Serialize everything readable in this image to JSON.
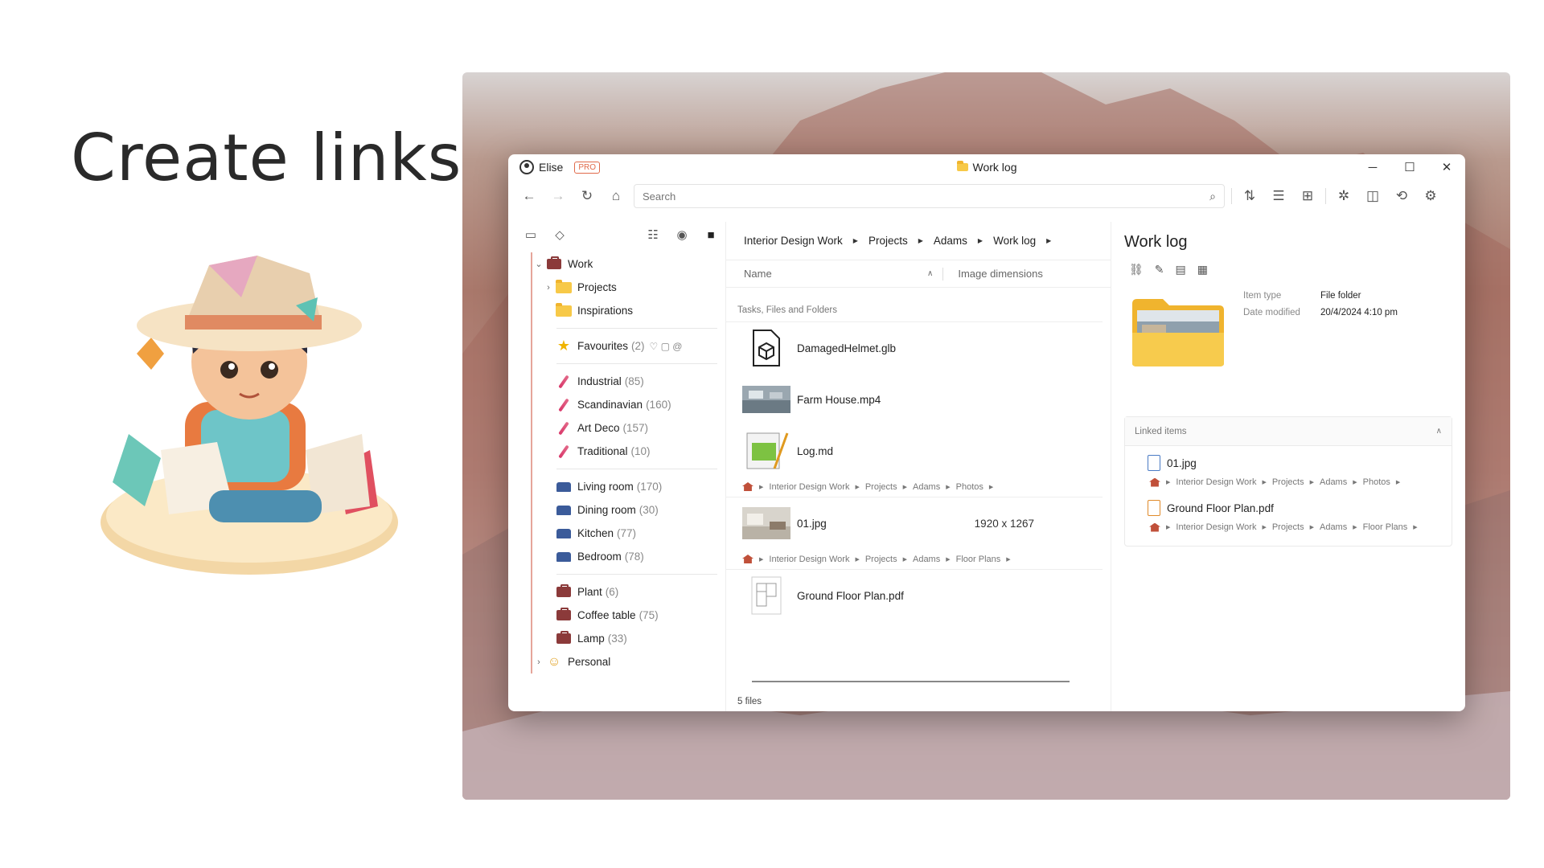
{
  "hero": {
    "title": "Create links"
  },
  "window": {
    "user": "Elise",
    "badge": "PRO",
    "title": "Work log",
    "controls": {
      "minimize": "─",
      "maximize": "☐",
      "close": "✕"
    }
  },
  "toolbar": {
    "search_placeholder": "Search"
  },
  "sidebar": {
    "tree": [
      {
        "label": "Work",
        "count": ""
      },
      {
        "label": "Projects",
        "count": ""
      },
      {
        "label": "Inspirations",
        "count": ""
      }
    ],
    "favourites": {
      "label": "Favourites",
      "count": "(2)"
    },
    "styles": [
      {
        "label": "Industrial",
        "count": "(85)"
      },
      {
        "label": "Scandinavian",
        "count": "(160)"
      },
      {
        "label": "Art Deco",
        "count": "(157)"
      },
      {
        "label": "Traditional",
        "count": "(10)"
      }
    ],
    "rooms": [
      {
        "label": "Living room",
        "count": "(170)"
      },
      {
        "label": "Dining room",
        "count": "(30)"
      },
      {
        "label": "Kitchen",
        "count": "(77)"
      },
      {
        "label": "Bedroom",
        "count": "(78)"
      }
    ],
    "objects": [
      {
        "label": "Plant",
        "count": "(6)"
      },
      {
        "label": "Coffee table",
        "count": "(75)"
      },
      {
        "label": "Lamp",
        "count": "(33)"
      }
    ],
    "personal": "Personal"
  },
  "main": {
    "breadcrumbs": [
      "Interior Design Work",
      "Projects",
      "Adams",
      "Work log"
    ],
    "columns": {
      "name": "Name",
      "dims": "Image dimensions"
    },
    "group": "Tasks, Files and Folders",
    "files": [
      {
        "name": "DamagedHelmet.glb",
        "dims": ""
      },
      {
        "name": "Farm House.mp4",
        "dims": ""
      },
      {
        "name": "Log.md",
        "dims": ""
      },
      {
        "name": "01.jpg",
        "dims": "1920 x 1267"
      },
      {
        "name": "Ground Floor Plan.pdf",
        "dims": ""
      }
    ],
    "path_photos": [
      "Interior Design Work",
      "Projects",
      "Adams",
      "Photos"
    ],
    "path_plans": [
      "Interior Design Work",
      "Projects",
      "Adams",
      "Floor Plans"
    ],
    "status": "5 files"
  },
  "detail": {
    "title": "Work log",
    "item_type_label": "Item type",
    "item_type": "File folder",
    "modified_label": "Date modified",
    "modified": "20/4/2024 4:10 pm",
    "linked_title": "Linked items",
    "linked": [
      {
        "name": "01.jpg",
        "path": [
          "Interior Design Work",
          "Projects",
          "Adams",
          "Photos"
        ]
      },
      {
        "name": "Ground Floor Plan.pdf",
        "path": [
          "Interior Design Work",
          "Projects",
          "Adams",
          "Floor Plans"
        ]
      }
    ]
  },
  "colors": {
    "accent": "#e06a4a",
    "folder": "#f7c948",
    "tree_line": "#e6a59a"
  }
}
